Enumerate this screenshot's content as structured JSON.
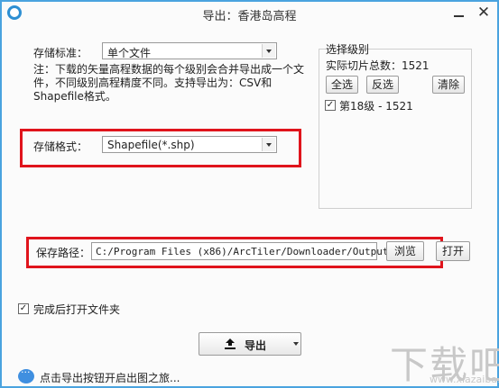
{
  "window": {
    "title": "导出：香港岛高程",
    "close_glyph": "✕"
  },
  "storage": {
    "standard_label": "存储标准：",
    "standard_value": "单个文件",
    "note": "注：下载的矢量高程数据的每个级别会合并导出成一个文件，不同级别高程精度不同。支持导出为：CSV和Shapefile格式。",
    "format_label": "存储格式：",
    "format_value": "Shapefile(*.shp)",
    "path_label": "保存路径：",
    "path_value": "C:/Program Files (x86)/ArcTiler/Downloader/Output",
    "browse_label": "浏览",
    "open_label": "打开"
  },
  "levels": {
    "title": "选择级别",
    "tile_count": "实际切片总数：1521",
    "select_all": "全选",
    "invert": "反选",
    "clear": "清除",
    "items": [
      {
        "label": "第18级 - 1521",
        "checked": true
      }
    ]
  },
  "open_after": {
    "label": "完成后打开文件夹",
    "checked": true
  },
  "export": {
    "label": "导出",
    "icon": "upload-icon"
  },
  "status": {
    "text": "点击导出按钮开启出图之旅..."
  },
  "watermark": {
    "text": "下载吧",
    "sub": "www.xiazaiba.com"
  },
  "colors": {
    "highlight": "#e0141c",
    "window_border": "#4aa3df",
    "accent": "#2d8fd3"
  }
}
